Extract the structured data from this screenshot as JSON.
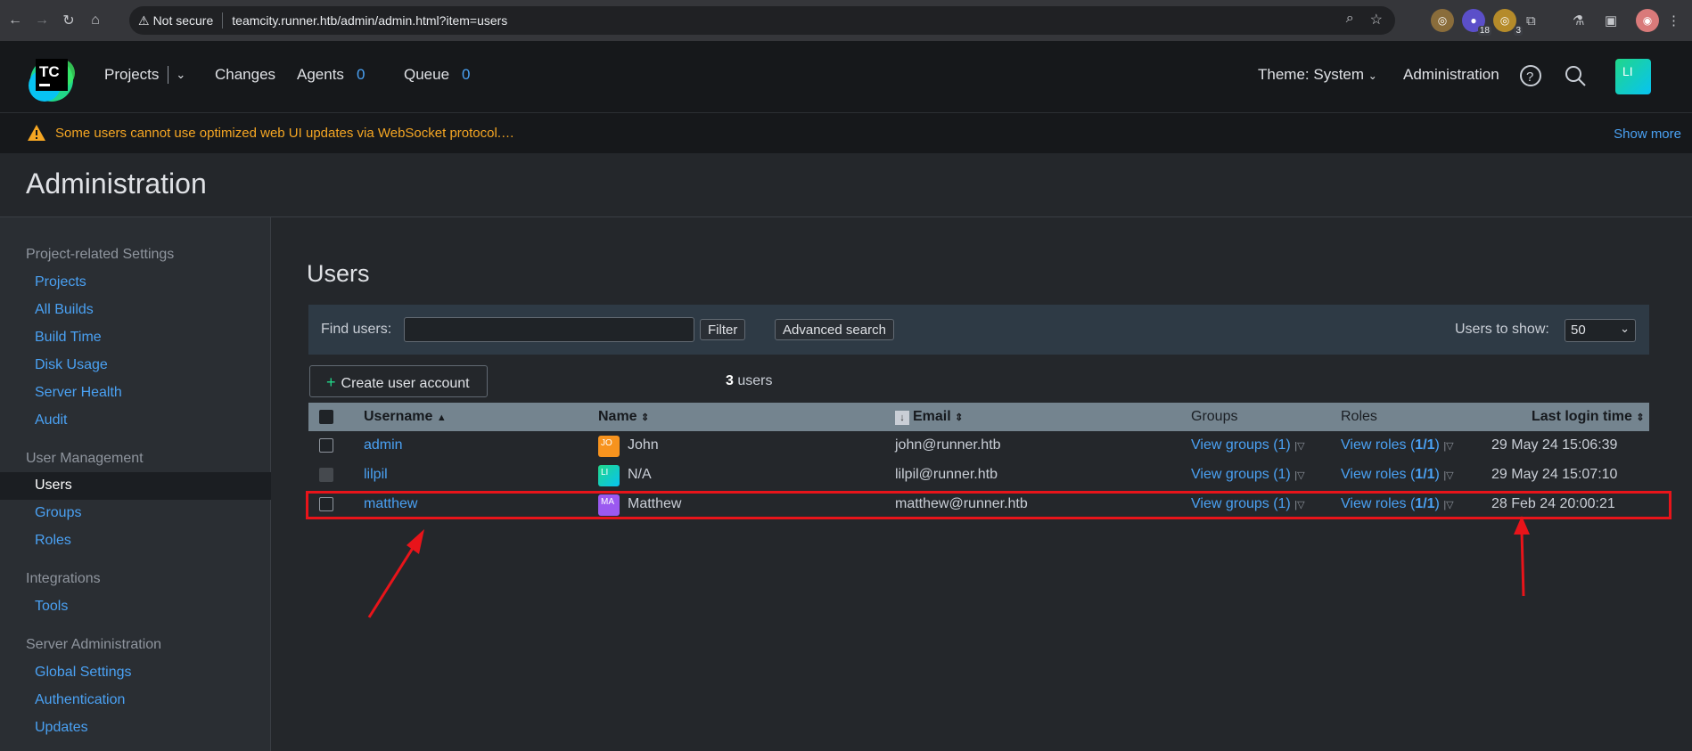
{
  "browser": {
    "security_label": "Not secure",
    "url": "teamcity.runner.htb/admin/admin.html?item=users",
    "ext_badge_1": "18",
    "ext_badge_2": "3"
  },
  "header": {
    "logo_text": "TC",
    "nav": {
      "projects": "Projects",
      "changes": "Changes",
      "agents": "Agents",
      "agents_count": "0",
      "queue": "Queue",
      "queue_count": "0"
    },
    "theme": "Theme: System",
    "administration": "Administration",
    "avatar": "LI"
  },
  "warning": {
    "text": "Some users cannot use optimized web UI updates via WebSocket protocol.…",
    "show_more": "Show more"
  },
  "page_title": "Administration",
  "sidebar": {
    "sections": [
      {
        "title": "Project-related Settings",
        "items": [
          "Projects",
          "All Builds",
          "Build Time",
          "Disk Usage",
          "Server Health",
          "Audit"
        ]
      },
      {
        "title": "User Management",
        "items": [
          "Users",
          "Groups",
          "Roles"
        ]
      },
      {
        "title": "Integrations",
        "items": [
          "Tools"
        ]
      },
      {
        "title": "Server Administration",
        "items": [
          "Global Settings",
          "Authentication",
          "Updates"
        ]
      }
    ],
    "active": "Users"
  },
  "main": {
    "title": "Users",
    "find_label": "Find users:",
    "find_value": "",
    "filter_btn": "Filter",
    "advanced_btn": "Advanced search",
    "show_label": "Users to show:",
    "show_value": "50",
    "create_btn": "Create user account",
    "count_num": "3",
    "count_suffix": " users",
    "columns": {
      "username": "Username",
      "name": "Name",
      "email": "Email",
      "groups": "Groups",
      "roles": "Roles",
      "last_login": "Last login time"
    },
    "rows": [
      {
        "username": "admin",
        "avatar": "JO",
        "avatar_color": "#f7931e",
        "name": "John",
        "email": "john@runner.htb",
        "groups": "View groups (1)",
        "roles_pre": "View roles (",
        "roles_bold": "1/1",
        "roles_post": ")",
        "last_login": "29 May 24 15:06:39"
      },
      {
        "username": "lilpil",
        "avatar": "LI",
        "avatar_color": "#13b988",
        "name": "N/A",
        "email": "lilpil@runner.htb",
        "groups": "View groups (1)",
        "roles_pre": "View roles (",
        "roles_bold": "1/1",
        "roles_post": ")",
        "last_login": "29 May 24 15:07:10"
      },
      {
        "username": "matthew",
        "avatar": "MA",
        "avatar_color": "#9b59f0",
        "name": "Matthew",
        "email": "matthew@runner.htb",
        "groups": "View groups (1)",
        "roles_pre": "View roles (",
        "roles_bold": "1/1",
        "roles_post": ")",
        "last_login": "28 Feb 24 20:00:21"
      }
    ]
  },
  "colors": {
    "accent": "#4aa1f3",
    "warning": "#f5a623",
    "annotation": "#e8141a"
  }
}
